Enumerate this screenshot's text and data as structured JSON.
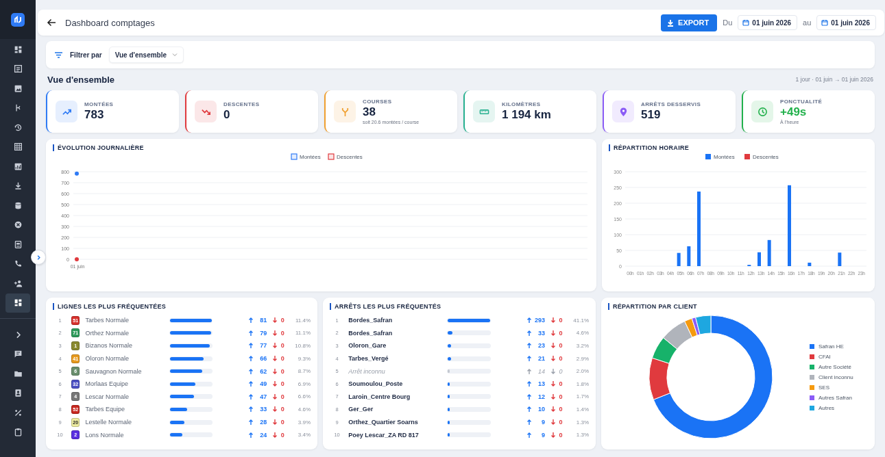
{
  "sidebar": {
    "nav_items": [
      {
        "kind": "grid",
        "selected": false
      },
      {
        "kind": "list",
        "selected": false
      },
      {
        "kind": "image",
        "selected": false
      },
      {
        "kind": "branch",
        "selected": false
      },
      {
        "kind": "history",
        "selected": false
      },
      {
        "kind": "table",
        "selected": false
      },
      {
        "kind": "chart",
        "selected": false
      },
      {
        "kind": "download",
        "selected": false
      },
      {
        "kind": "database",
        "selected": false
      },
      {
        "kind": "cancel",
        "selected": false
      },
      {
        "kind": "card",
        "selected": false
      },
      {
        "kind": "phone",
        "selected": false
      },
      {
        "kind": "person-add",
        "selected": false
      },
      {
        "kind": "grid",
        "selected": true
      }
    ],
    "bottom_items": [
      {
        "kind": "chevron",
        "selected": false
      },
      {
        "kind": "chat",
        "selected": false
      },
      {
        "kind": "folder",
        "selected": false
      },
      {
        "kind": "contact",
        "selected": false
      },
      {
        "kind": "percent",
        "selected": false
      },
      {
        "kind": "clipboard",
        "selected": false
      }
    ]
  },
  "header": {
    "title": "Dashboard comptages",
    "export": "EXPORT",
    "from_label": "Du",
    "from_date": "01 juin 2026",
    "to_label": "au",
    "to_date": "01 juin 2026"
  },
  "filter": {
    "label": "Filtrer par",
    "value": "Vue d'ensemble"
  },
  "section": {
    "title": "Vue d'ensemble",
    "range": "1 jour · 01 juin → 01 juin 2026"
  },
  "kpis": [
    {
      "kind": "trend-up",
      "label": "MONTÉES",
      "value": "783",
      "color": "#2f7bf5",
      "highlight": false
    },
    {
      "kind": "trend-down",
      "label": "DESCENTES",
      "value": "0",
      "color": "#e03a3e",
      "highlight": false
    },
    {
      "kind": "fork",
      "label": "COURSES",
      "value": "38",
      "sub": "soit 20.6 montées / course",
      "color": "#f0a030",
      "highlight": false
    },
    {
      "kind": "ruler",
      "label": "KILOMÈTRES",
      "value": "1 194 km",
      "color": "#26b08f",
      "highlight": false
    },
    {
      "kind": "pin",
      "label": "ARRÊTS DESSERVIS",
      "value": "519",
      "color": "#8b5cf6",
      "highlight": false
    },
    {
      "kind": "clock",
      "label": "PONCTUALITÉ",
      "value": "+49s",
      "sub": "À l'heure",
      "color": "#22b14c",
      "highlight": true
    }
  ],
  "daily": {
    "title": "ÉVOLUTION JOURNALIÈRE",
    "chart_data": {
      "type": "line",
      "categories": [
        "01 juin"
      ],
      "series": [
        {
          "name": "Montées",
          "color": "#2f7bf5",
          "values": [
            783
          ],
          "marker": true
        },
        {
          "name": "Descentes",
          "color": "#e03a3e",
          "values": [
            0
          ],
          "marker": true
        }
      ],
      "grid": true,
      "legend": true,
      "ylim": [
        0,
        800
      ],
      "yticks": [
        0,
        100,
        200,
        300,
        400,
        500,
        600,
        700,
        800
      ]
    }
  },
  "hourly": {
    "title": "RÉPARTITION HORAIRE",
    "chart_data": {
      "type": "bar",
      "categories": [
        "00h",
        "01h",
        "02h",
        "03h",
        "04h",
        "05h",
        "06h",
        "07h",
        "08h",
        "09h",
        "10h",
        "11h",
        "12h",
        "13h",
        "14h",
        "15h",
        "16h",
        "17h",
        "18h",
        "19h",
        "20h",
        "21h",
        "22h",
        "23h"
      ],
      "series": [
        {
          "name": "Montées",
          "color": "#1a73f5",
          "values": [
            0,
            0,
            0,
            0,
            0,
            42,
            63,
            237,
            0,
            0,
            0,
            0,
            4,
            44,
            83,
            0,
            257,
            0,
            11,
            0,
            0,
            43,
            0,
            0
          ]
        },
        {
          "name": "Descentes",
          "color": "#e03a3e",
          "values": [
            0,
            0,
            0,
            0,
            0,
            0,
            0,
            0,
            0,
            0,
            0,
            0,
            0,
            0,
            0,
            0,
            0,
            0,
            0,
            0,
            0,
            0,
            0,
            0
          ]
        }
      ],
      "grid": true,
      "legend": true,
      "ylim": [
        0,
        300
      ],
      "yticks": [
        0,
        50,
        100,
        150,
        200,
        250,
        300
      ]
    }
  },
  "lines": {
    "title": "LIGNES LES PLUS FRÉQUENTÉES",
    "rows": [
      {
        "rank": "1",
        "code": "51",
        "color": "#d7312c",
        "name": "Tarbes Normale",
        "level": 1,
        "up": "81",
        "down": "0",
        "share": "11.4%"
      },
      {
        "rank": "2",
        "code": "71",
        "color": "#2e9b5b",
        "name": "Orthez Normale",
        "level": 0.975,
        "up": "79",
        "down": "0",
        "share": "11.1%"
      },
      {
        "rank": "3",
        "code": "1",
        "color": "#8a8a30",
        "name": "Bizanos Normale",
        "level": 0.95,
        "up": "77",
        "down": "0",
        "share": "10.8%"
      },
      {
        "rank": "4",
        "code": "41",
        "color": "#e79a1e",
        "name": "Oloron Normale",
        "level": 0.81,
        "up": "66",
        "down": "0",
        "share": "9.3%"
      },
      {
        "rank": "5",
        "code": "6",
        "color": "#6a8f6d",
        "name": "Sauvagnon Normale",
        "level": 0.77,
        "up": "62",
        "down": "0",
        "share": "8.7%"
      },
      {
        "rank": "6",
        "code": "32",
        "color": "#4c50c4",
        "name": "Morlaas Equipe",
        "level": 0.61,
        "up": "49",
        "down": "0",
        "share": "6.9%"
      },
      {
        "rank": "7",
        "code": "4",
        "color": "#777777",
        "name": "Lescar Normale",
        "level": 0.58,
        "up": "47",
        "down": "0",
        "share": "6.6%"
      },
      {
        "rank": "8",
        "code": "52",
        "color": "#c8281f",
        "name": "Tarbes Equipe",
        "level": 0.41,
        "up": "33",
        "down": "0",
        "share": "4.6%"
      },
      {
        "rank": "9",
        "code": "20",
        "color": "#eeeda0",
        "name": "Lestelle Normale",
        "level": 0.35,
        "up": "28",
        "down": "0",
        "share": "3.9%"
      },
      {
        "rank": "10",
        "code": "2",
        "color": "#5a2ee0",
        "name": "Lons Normale",
        "level": 0.3,
        "up": "24",
        "down": "0",
        "share": "3.4%"
      }
    ]
  },
  "stops": {
    "title": "ARRÊTS LES PLUS FRÉQUENTÉS",
    "rows": [
      {
        "rank": "1",
        "name": "Bordes_Safran",
        "unknown": false,
        "level": 1,
        "up": "293",
        "down": "0",
        "share": "41.1%"
      },
      {
        "rank": "2",
        "name": "Bordes_Safran",
        "unknown": false,
        "level": 0.11,
        "up": "33",
        "down": "0",
        "share": "4.6%"
      },
      {
        "rank": "3",
        "name": "Oloron_Gare",
        "unknown": false,
        "level": 0.08,
        "up": "23",
        "down": "0",
        "share": "3.2%"
      },
      {
        "rank": "4",
        "name": "Tarbes_Vergé",
        "unknown": false,
        "level": 0.07,
        "up": "21",
        "down": "0",
        "share": "2.9%"
      },
      {
        "rank": "5",
        "name": "Arrêt inconnu",
        "unknown": true,
        "level": 0.05,
        "up": "14",
        "down": "0",
        "share": "2.0%"
      },
      {
        "rank": "6",
        "name": "Soumoulou_Poste",
        "unknown": false,
        "level": 0.045,
        "up": "13",
        "down": "0",
        "share": "1.8%"
      },
      {
        "rank": "7",
        "name": "Laroin_Centre Bourg",
        "unknown": false,
        "level": 0.04,
        "up": "12",
        "down": "0",
        "share": "1.7%"
      },
      {
        "rank": "8",
        "name": "Ger_Ger",
        "unknown": false,
        "level": 0.035,
        "up": "10",
        "down": "0",
        "share": "1.4%"
      },
      {
        "rank": "9",
        "name": "Orthez_Quartier Soarns",
        "unknown": false,
        "level": 0.03,
        "up": "9",
        "down": "0",
        "share": "1.3%"
      },
      {
        "rank": "10",
        "name": "Poey Lescar_ZA RD 817",
        "unknown": false,
        "level": 0.03,
        "up": "9",
        "down": "0",
        "share": "1.3%"
      }
    ]
  },
  "clients": {
    "title": "RÉPARTITION PAR CLIENT",
    "chart_data": {
      "type": "donut",
      "categories": [
        "Safran HE",
        "CFAI",
        "Autre Société",
        "Client inconnu",
        "SES",
        "Autres Safran",
        "Autres"
      ],
      "values": [
        69,
        11,
        6,
        7,
        2,
        1,
        4
      ],
      "legend": true,
      "colors": [
        "#1a73f5",
        "#e03a3e",
        "#17b26a",
        "#b0b4bb",
        "#f59a10",
        "#8b5cf6",
        "#1ea7e0"
      ]
    }
  }
}
